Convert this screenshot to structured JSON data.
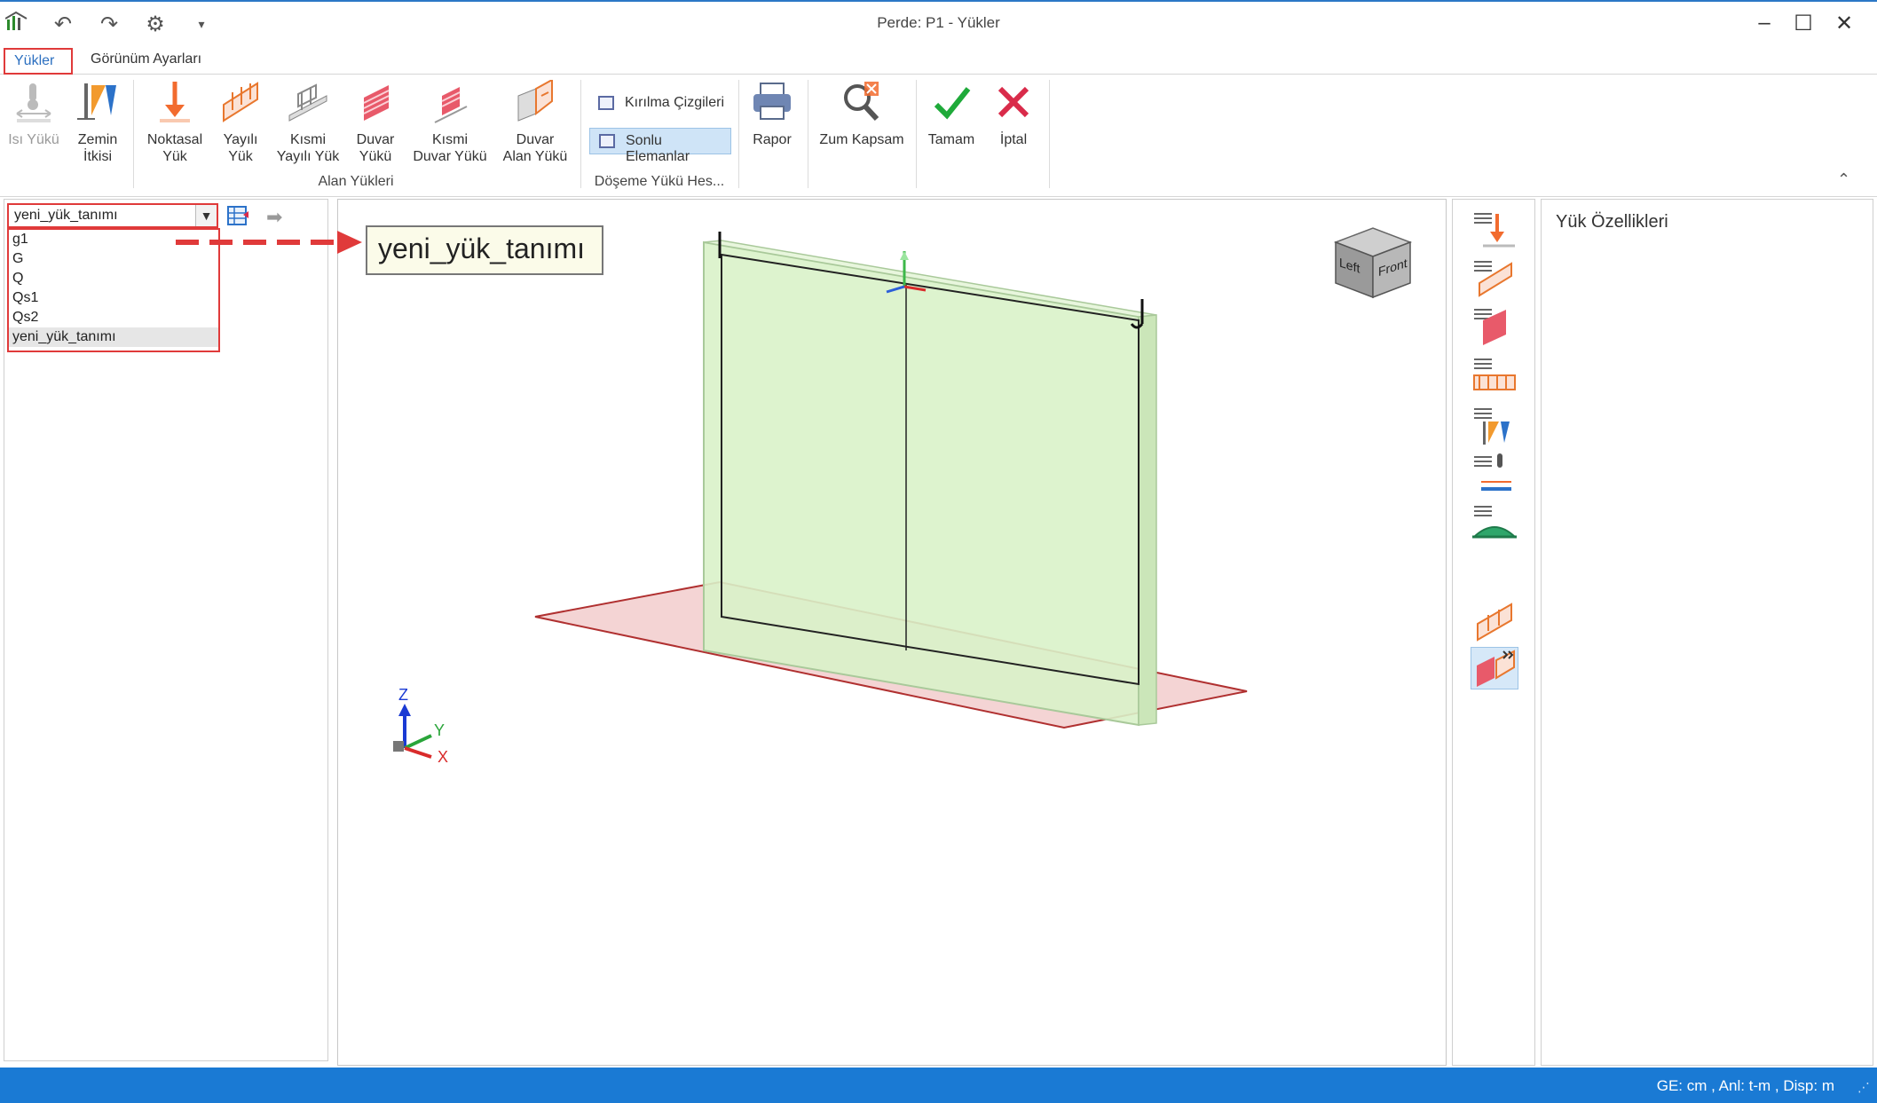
{
  "window": {
    "title": "Perde: P1 - Yükler",
    "minimize": "–",
    "maximize": "☐",
    "close": "✕"
  },
  "quick_access": {
    "undo": "↶",
    "redo": "↷",
    "settings": "⚙",
    "customize": "▾"
  },
  "tabs": [
    {
      "label": "Yükler",
      "active": true
    },
    {
      "label": "Görünüm Ayarları",
      "active": false
    }
  ],
  "ribbon": {
    "isi_yuku": [
      "Isı Yükü"
    ],
    "zemin_itkisi": [
      "Zemin",
      "İtkisi"
    ],
    "noktasal_yuk": [
      "Noktasal",
      "Yük"
    ],
    "yayili_yuk": [
      "Yayılı",
      "Yük"
    ],
    "kismi_yayili_yuk": [
      "Kısmi",
      "Yayılı Yük"
    ],
    "duvar_yuku": [
      "Duvar",
      "Yükü"
    ],
    "kismi_duvar_yuku": [
      "Kısmi",
      "Duvar Yükü"
    ],
    "duvar_alan_yuku": [
      "Duvar",
      "Alan Yükü"
    ],
    "alan_yukleri_label": "Alan Yükleri",
    "kirilma_cizgileri": "Kırılma Çizgileri",
    "sonlu_elemanlar": "Sonlu Elemanlar",
    "doseme_label": "Döşeme Yükü Hes...",
    "rapor": "Rapor",
    "zum_kapsam": "Zum Kapsam",
    "tamam": "Tamam",
    "iptal": "İptal",
    "collapse": "⌃"
  },
  "load_case": {
    "selected": "yeni_yük_tanımı",
    "options": [
      "g1",
      "G",
      "Q",
      "Qs1",
      "Qs2",
      "yeni_yük_tanımı"
    ]
  },
  "tooltip": "yeni_yük_tanımı",
  "viewport": {
    "view_cube_left": "Left",
    "view_cube_front": "Front",
    "axis_z": "Z",
    "axis_y": "Y",
    "axis_x": "X",
    "node_i": "I",
    "node_j": "J"
  },
  "properties": {
    "title": "Yük Özellikleri"
  },
  "status": {
    "text": "GE: cm , Anl: t-m , Disp: m",
    "grip": "⋰"
  },
  "colors": {
    "accent": "#1a7ad4",
    "highlight_red": "#e03a3a",
    "wall_fill": "#d9f2c9",
    "floor_fill": "#f1c9c9"
  }
}
